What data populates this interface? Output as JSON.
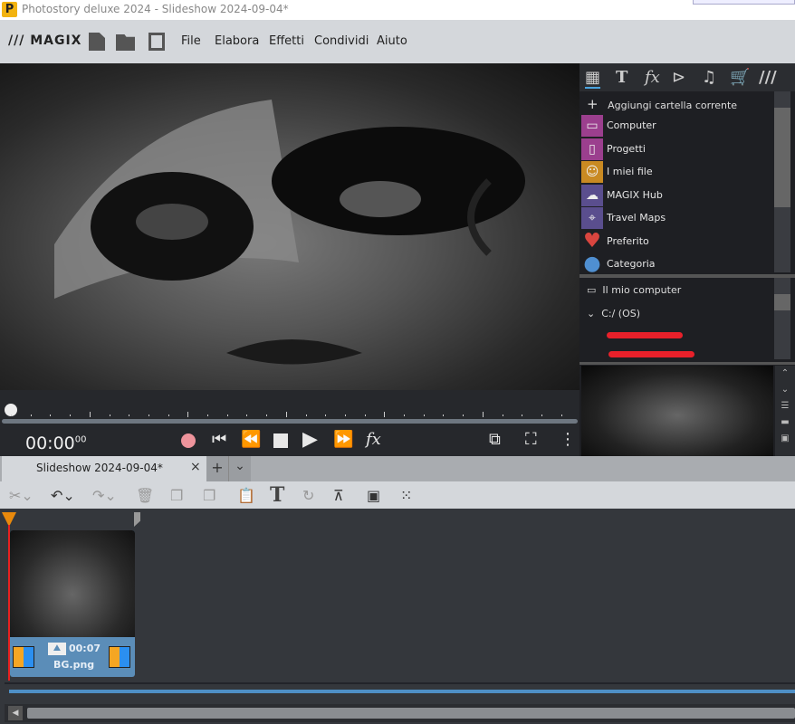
{
  "window": {
    "title": "Photostory deluxe 2024 - Slideshow 2024-09-04*",
    "app_logo": "P"
  },
  "menu": {
    "brand": "/// MAGIX",
    "items": [
      "File",
      "Elabora",
      "Effetti",
      "Condividi",
      "Aiuto"
    ]
  },
  "player": {
    "timecode": "00:00",
    "timecode_frames": "00"
  },
  "media_panel": {
    "add_folder": "Aggiungi cartella corrente",
    "items": [
      {
        "label": "Computer",
        "color": "#9b3f8e"
      },
      {
        "label": "Progetti",
        "color": "#9b3f8e"
      },
      {
        "label": "I miei file",
        "color": "#c98a22"
      },
      {
        "label": "MAGIX Hub",
        "color": "#5a4e8e"
      },
      {
        "label": "Travel Maps",
        "color": "#5a4e8e"
      },
      {
        "label": "Preferito",
        "color": "#d9453f"
      },
      {
        "label": "Categoria",
        "color": "#4f8fd1"
      }
    ],
    "tree_root": "Il mio computer",
    "drive": "C:/ (OS)"
  },
  "project_tab": {
    "label": "Slideshow 2024-09-04*",
    "close": "×",
    "add": "+",
    "more": "⌄"
  },
  "clip": {
    "duration": "00:07",
    "filename": "BG.png"
  }
}
